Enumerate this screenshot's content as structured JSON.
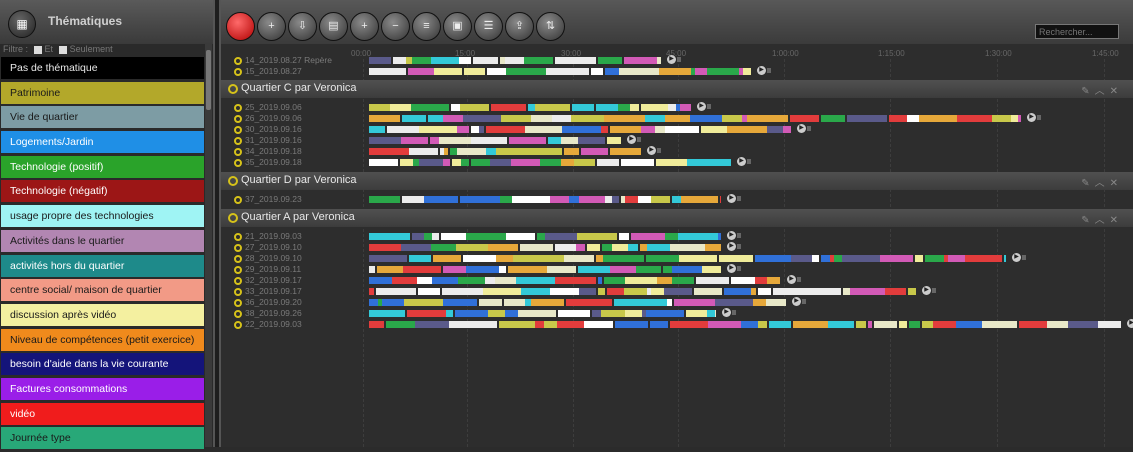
{
  "left_panel": {
    "title": "Thématiques",
    "filter_label": "Filtre :",
    "filter_et": "Et",
    "filter_seulement": "Seulement",
    "themes": [
      {
        "label": "Pas de thématique",
        "color": "#000000",
        "text": "#e8e8e8"
      },
      {
        "label": "Patrimoine",
        "color": "#b3a82a",
        "text": "#1a1a1a"
      },
      {
        "label": "Vie de quartier",
        "color": "#7d9ca4",
        "text": "#1a1a1a"
      },
      {
        "label": "Logements/Jardin",
        "color": "#1f8fe6",
        "text": "#ffffff"
      },
      {
        "label": "Technologie (positif)",
        "color": "#2aa32a",
        "text": "#ffffff"
      },
      {
        "label": "Technologie (négatif)",
        "color": "#9c1616",
        "text": "#ffffff"
      },
      {
        "label": "usage propre des technologies",
        "color": "#9ff4f4",
        "text": "#1a1a1a"
      },
      {
        "label": "Activités dans le quartier",
        "color": "#b286b2",
        "text": "#1a1a1a"
      },
      {
        "label": "activités hors du quartier",
        "color": "#1e8a8a",
        "text": "#ffffff"
      },
      {
        "label": "centre social/ maison de quartier",
        "color": "#f29a86",
        "text": "#1a1a1a"
      },
      {
        "label": "discussion après vidéo",
        "color": "#f4f0a0",
        "text": "#1a1a1a"
      },
      {
        "label": "Niveau de compétences (petit exercice)",
        "color": "#f08a1c",
        "text": "#1a1a1a"
      },
      {
        "label": "besoin d'aide dans la vie courante",
        "color": "#14147a",
        "text": "#ffffff"
      },
      {
        "label": "Factures consommations",
        "color": "#9a1ee8",
        "text": "#ffffff"
      },
      {
        "label": "vidéo",
        "color": "#f01c1c",
        "text": "#ffffff"
      },
      {
        "label": "Journée type",
        "color": "#28a878",
        "text": "#1a1a1a"
      }
    ]
  },
  "toolbar": {
    "icons": [
      "record-icon",
      "add-icon",
      "import-icon",
      "document-icon",
      "add-person-icon",
      "remove-person-icon",
      "list-icon",
      "image-icon",
      "edit-list-icon",
      "export-icon",
      "sort-icon"
    ],
    "search_placeholder": "Rechercher..."
  },
  "timeline": {
    "ruler_labels": [
      "00:00",
      "15:00",
      "30:00",
      "45:00",
      "1:00:00",
      "1:15:00",
      "1:30:00",
      "1:45:00"
    ],
    "pre_rows": [
      "14_2019.08.27 Repère",
      "15_2019.08.27"
    ],
    "groups": [
      {
        "title": "Quartier C par Veronica",
        "rows": [
          "25_2019.09.06",
          "26_2019.09.06",
          "30_2019.09.16",
          "31_2019.09.16",
          "34_2019.09.18",
          "35_2019.09.18"
        ]
      },
      {
        "title": "Quartier D par Veronica",
        "rows": [
          "37_2019.09.23"
        ]
      },
      {
        "title": "Quartier A par Veronica",
        "rows": [
          "21_2019.09.03",
          "27_2019.09.10",
          "28_2019.09.10",
          "29_2019.09.11",
          "32_2019.09.17",
          "33_2019.09.17",
          "36_2019.09.20",
          "38_2019.09.26",
          "22_2019.09.03"
        ]
      }
    ]
  }
}
